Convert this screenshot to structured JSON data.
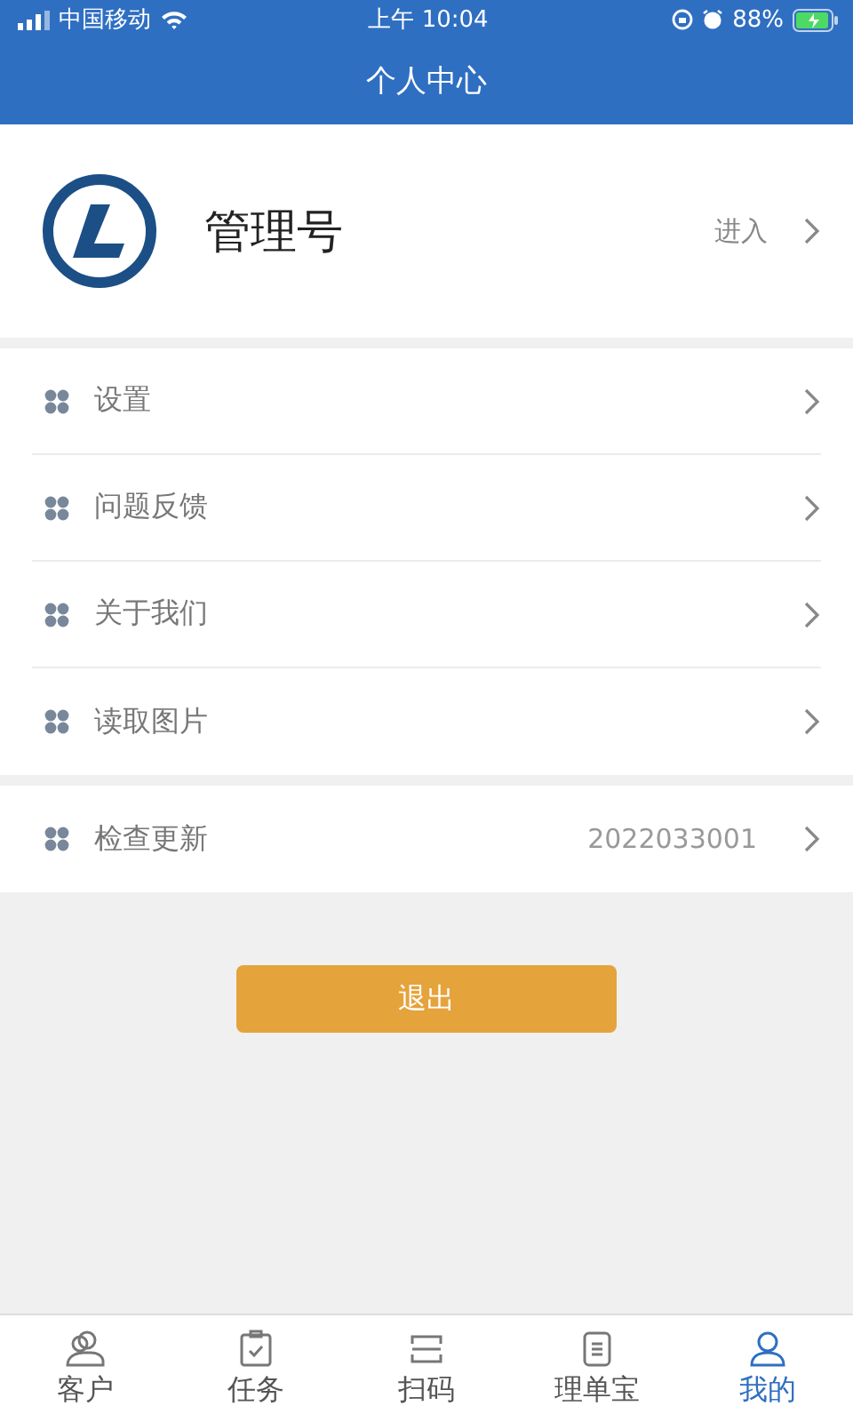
{
  "status_bar": {
    "carrier": "中国移动",
    "time": "上午 10:04",
    "battery": "88%"
  },
  "header": {
    "title": "个人中心"
  },
  "profile": {
    "name": "管理号",
    "action": "进入"
  },
  "menu_groups": [
    [
      {
        "label": "设置"
      },
      {
        "label": "问题反馈"
      },
      {
        "label": "关于我们"
      },
      {
        "label": "读取图片"
      }
    ],
    [
      {
        "label": "检查更新",
        "value": "2022033001"
      }
    ]
  ],
  "logout_button": "退出",
  "tabs": [
    {
      "label": "客户",
      "kind": "people",
      "selected": false
    },
    {
      "label": "任务",
      "kind": "clipboard",
      "selected": false
    },
    {
      "label": "扫码",
      "kind": "scan",
      "selected": false
    },
    {
      "label": "理单宝",
      "kind": "document",
      "selected": false
    },
    {
      "label": "我的",
      "kind": "person",
      "selected": true
    }
  ]
}
